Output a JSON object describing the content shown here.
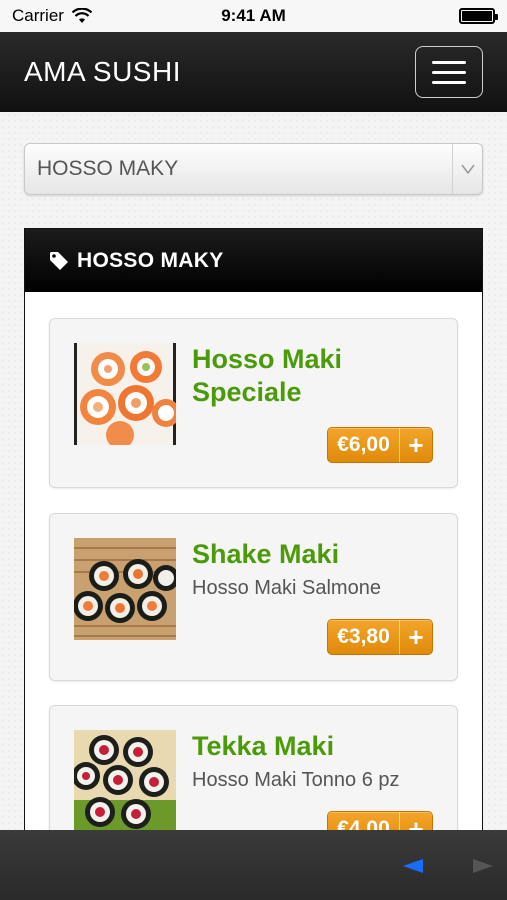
{
  "status_bar": {
    "carrier": "Carrier",
    "time": "9:41 AM"
  },
  "navbar": {
    "brand": "AMA SUSHI"
  },
  "category_select": {
    "selected": "HOSSO MAKY"
  },
  "panel": {
    "title": "HOSSO MAKY",
    "items": [
      {
        "name": "Hosso Maki Speciale",
        "description": "",
        "price": "€6,00",
        "image": "salmon-maki-photo"
      },
      {
        "name": "Shake Maki",
        "description": "Hosso Maki Salmone",
        "price": "€3,80",
        "image": "salmon-hosomaki-photo"
      },
      {
        "name": "Tekka Maki",
        "description": "Hosso Maki Tonno 6 pz",
        "price": "€4,00",
        "image": "tuna-hosomaki-photo"
      }
    ]
  },
  "colors": {
    "accent_green": "#4a9a0a",
    "price_orange": "#e08a0a",
    "nav_blue": "#1a6cff"
  }
}
